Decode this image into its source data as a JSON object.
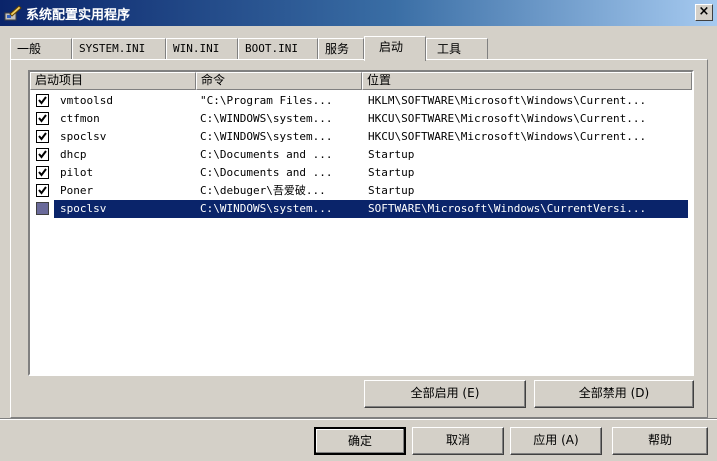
{
  "window": {
    "title": "系统配置实用程序",
    "close_label": "×"
  },
  "tabs": [
    {
      "label": "一般"
    },
    {
      "label": "SYSTEM.INI"
    },
    {
      "label": "WIN.INI"
    },
    {
      "label": "BOOT.INI"
    },
    {
      "label": "服务"
    },
    {
      "label": "启动"
    },
    {
      "label": "工具"
    }
  ],
  "active_tab": "启动",
  "startup_list": {
    "columns": [
      "启动项目",
      "命令",
      "位置"
    ],
    "rows": [
      {
        "name": "vmtoolsd",
        "command": "\"C:\\Program Files...",
        "location": "HKLM\\SOFTWARE\\Microsoft\\Windows\\Current...",
        "checked": true
      },
      {
        "name": "ctfmon",
        "command": "C:\\WINDOWS\\system...",
        "location": "HKCU\\SOFTWARE\\Microsoft\\Windows\\Current...",
        "checked": true
      },
      {
        "name": "spoclsv",
        "command": "C:\\WINDOWS\\system...",
        "location": "HKCU\\SOFTWARE\\Microsoft\\Windows\\Current...",
        "checked": true
      },
      {
        "name": "dhcp",
        "command": "C:\\Documents and ...",
        "location": "Startup",
        "checked": true
      },
      {
        "name": "pilot",
        "command": "C:\\Documents and ...",
        "location": "Startup",
        "checked": true
      },
      {
        "name": "Poner",
        "command": "C:\\debuger\\吾爱破...",
        "location": "Startup",
        "checked": true
      },
      {
        "name": "spoclsv",
        "command": "C:\\WINDOWS\\system...",
        "location": "SOFTWARE\\Microsoft\\Windows\\CurrentVersi...",
        "checked": false,
        "selected": true
      }
    ]
  },
  "buttons": {
    "enable_all": "全部启用 (E)",
    "disable_all": "全部禁用 (D)",
    "ok": "确定",
    "cancel": "取消",
    "apply": "应用 (A)",
    "help": "帮助"
  },
  "colors": {
    "selection": "#0a246a",
    "face": "#d4d0c8",
    "title_start": "#0a246a",
    "title_end": "#a6caf0"
  }
}
